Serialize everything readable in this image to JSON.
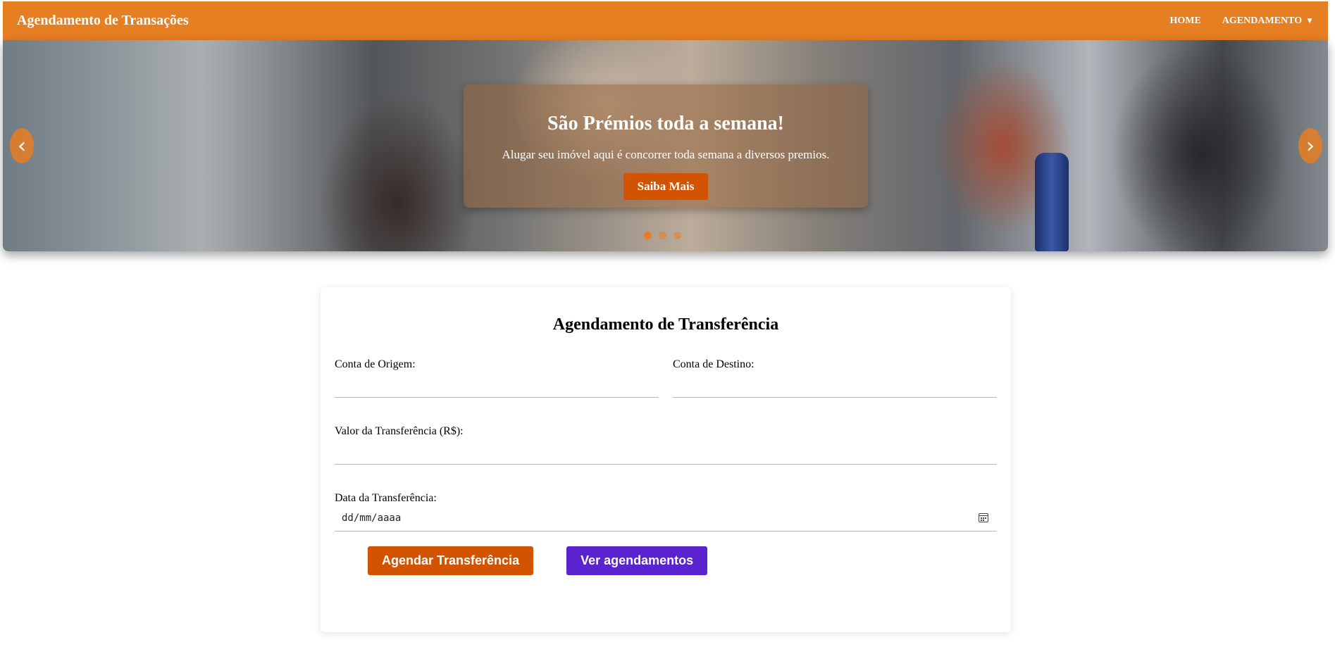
{
  "navbar": {
    "brand": "Agendamento de Transações",
    "links": {
      "home": "HOME",
      "agendamento": "AGENDAMENTO",
      "agendamento_caret": "▼"
    },
    "color": "#e67e22"
  },
  "carousel": {
    "title": "São Prémios toda a semana!",
    "text": "Alugar seu imóvel aqui é concorrer toda semana a diversos premios.",
    "button": "Saiba Mais",
    "prev_icon": "‹",
    "next_icon": "›",
    "slides": 3,
    "active_slide": 1
  },
  "form": {
    "title": "Agendamento de Transferência",
    "origem_label": "Conta de Origem:",
    "destino_label": "Conta de Destino:",
    "valor_label": "Valor da Transferência (R$):",
    "data_label": "Data da Transferência:",
    "data_placeholder": "dd/mm/aaaa",
    "submit_label": "Agendar Transferência",
    "view_label": "Ver agendamentos"
  },
  "colors": {
    "accent": "#e67e22",
    "primary_button": "#d35400",
    "secondary_button": "#5b22cf"
  }
}
